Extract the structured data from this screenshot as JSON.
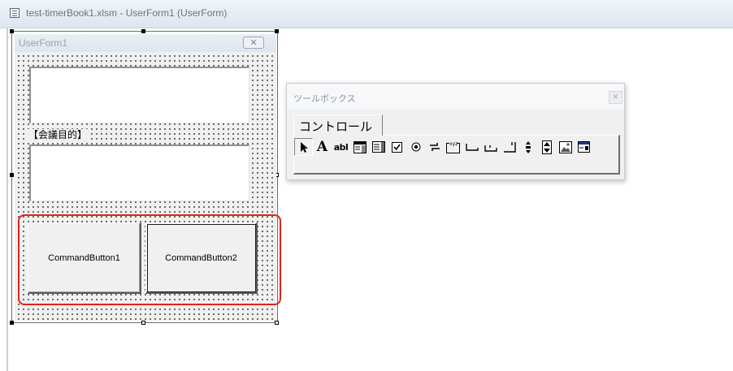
{
  "window": {
    "title": "test-timerBook1.xlsm - UserForm1 (UserForm)"
  },
  "userform": {
    "caption": "UserForm1",
    "close_glyph": "✕",
    "label_purpose": "【会議目的】",
    "command_button_1": "CommandButton1",
    "command_button_2": "CommandButton2"
  },
  "toolbox": {
    "title": "ツールボックス",
    "close_glyph": "✕",
    "tab_label": "コントロール",
    "tools": [
      {
        "name": "select-objects-icon"
      },
      {
        "name": "label-tool-icon",
        "glyph": "A"
      },
      {
        "name": "textbox-tool-icon",
        "glyph": "abl"
      },
      {
        "name": "combobox-tool-icon"
      },
      {
        "name": "listbox-tool-icon"
      },
      {
        "name": "checkbox-tool-icon"
      },
      {
        "name": "optionbutton-tool-icon"
      },
      {
        "name": "togglebutton-tool-icon"
      },
      {
        "name": "frame-tool-icon"
      },
      {
        "name": "commandbutton-tool-icon"
      },
      {
        "name": "tabstrip-tool-icon"
      },
      {
        "name": "multipage-tool-icon"
      },
      {
        "name": "scrollbar-tool-icon"
      },
      {
        "name": "spinbutton-tool-icon"
      },
      {
        "name": "image-tool-icon"
      },
      {
        "name": "refedit-tool-icon"
      }
    ]
  },
  "colors": {
    "highlight": "#e2231a"
  }
}
